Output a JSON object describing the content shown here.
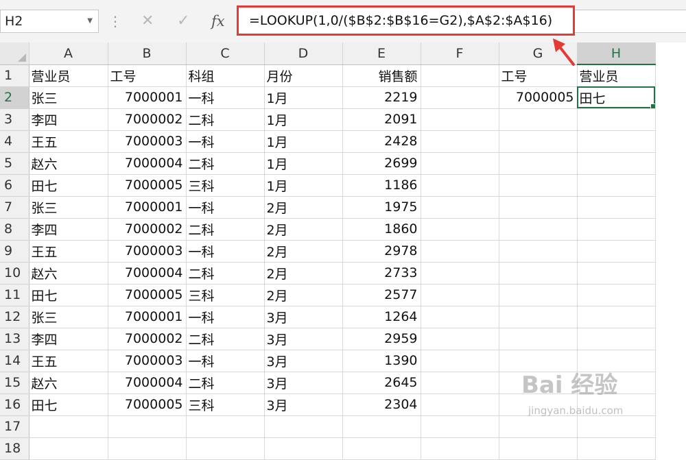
{
  "formula_bar": {
    "name_box": "H2",
    "cancel_glyph": "✕",
    "enter_glyph": "✓",
    "fx_label": "fx",
    "formula": "=LOOKUP(1,0/($B$2:$B$16=G2),$A$2:$A$16)"
  },
  "columns": [
    "A",
    "B",
    "C",
    "D",
    "E",
    "F",
    "G",
    "H"
  ],
  "rows": [
    {
      "n": "1",
      "A": "营业员",
      "B": "工号",
      "C": "科组",
      "D": "月份",
      "E": "销售额",
      "F": "",
      "G": "工号",
      "H": "营业员"
    },
    {
      "n": "2",
      "A": "张三",
      "B": "7000001",
      "C": "一科",
      "D": "1月",
      "E": "2219",
      "F": "",
      "G": "7000005",
      "H": "田七"
    },
    {
      "n": "3",
      "A": "李四",
      "B": "7000002",
      "C": "二科",
      "D": "1月",
      "E": "2091",
      "F": "",
      "G": "",
      "H": ""
    },
    {
      "n": "4",
      "A": "王五",
      "B": "7000003",
      "C": "一科",
      "D": "1月",
      "E": "2428",
      "F": "",
      "G": "",
      "H": ""
    },
    {
      "n": "5",
      "A": "赵六",
      "B": "7000004",
      "C": "二科",
      "D": "1月",
      "E": "2699",
      "F": "",
      "G": "",
      "H": ""
    },
    {
      "n": "6",
      "A": "田七",
      "B": "7000005",
      "C": "三科",
      "D": "1月",
      "E": "1186",
      "F": "",
      "G": "",
      "H": ""
    },
    {
      "n": "7",
      "A": "张三",
      "B": "7000001",
      "C": "一科",
      "D": "2月",
      "E": "1975",
      "F": "",
      "G": "",
      "H": ""
    },
    {
      "n": "8",
      "A": "李四",
      "B": "7000002",
      "C": "二科",
      "D": "2月",
      "E": "1860",
      "F": "",
      "G": "",
      "H": ""
    },
    {
      "n": "9",
      "A": "王五",
      "B": "7000003",
      "C": "一科",
      "D": "2月",
      "E": "2978",
      "F": "",
      "G": "",
      "H": ""
    },
    {
      "n": "10",
      "A": "赵六",
      "B": "7000004",
      "C": "二科",
      "D": "2月",
      "E": "2733",
      "F": "",
      "G": "",
      "H": ""
    },
    {
      "n": "11",
      "A": "田七",
      "B": "7000005",
      "C": "三科",
      "D": "2月",
      "E": "2577",
      "F": "",
      "G": "",
      "H": ""
    },
    {
      "n": "12",
      "A": "张三",
      "B": "7000001",
      "C": "一科",
      "D": "3月",
      "E": "1264",
      "F": "",
      "G": "",
      "H": ""
    },
    {
      "n": "13",
      "A": "李四",
      "B": "7000002",
      "C": "二科",
      "D": "3月",
      "E": "2959",
      "F": "",
      "G": "",
      "H": ""
    },
    {
      "n": "14",
      "A": "王五",
      "B": "7000003",
      "C": "一科",
      "D": "3月",
      "E": "1390",
      "F": "",
      "G": "",
      "H": ""
    },
    {
      "n": "15",
      "A": "赵六",
      "B": "7000004",
      "C": "二科",
      "D": "3月",
      "E": "2645",
      "F": "",
      "G": "",
      "H": ""
    },
    {
      "n": "16",
      "A": "田七",
      "B": "7000005",
      "C": "三科",
      "D": "3月",
      "E": "2304",
      "F": "",
      "G": "",
      "H": ""
    },
    {
      "n": "17",
      "A": "",
      "B": "",
      "C": "",
      "D": "",
      "E": "",
      "F": "",
      "G": "",
      "H": ""
    },
    {
      "n": "18",
      "A": "",
      "B": "",
      "C": "",
      "D": "",
      "E": "",
      "F": "",
      "G": "",
      "H": ""
    }
  ],
  "active_cell": {
    "col": "H",
    "row": "2"
  },
  "watermark": {
    "logo": "Bai 经验",
    "url": "jingyan.baidu.com"
  },
  "colors": {
    "selection": "#217346",
    "annotation": "#e53935"
  }
}
